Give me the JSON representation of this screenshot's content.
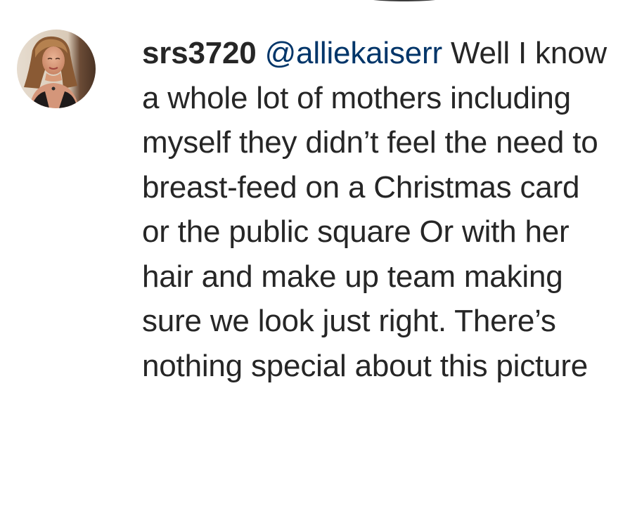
{
  "comment": {
    "username": "srs3720",
    "mention": "@alliekaiserr",
    "text": "Well I know a whole lot of mothers including myself they didn’t feel the need to breast-feed on a Christmas card or the public square Or with her hair and make up team making sure we look just right. There’s nothing special about this picture"
  },
  "colors": {
    "text": "#262626",
    "mention": "#003569",
    "background": "#ffffff"
  },
  "icons": {
    "avatar": "user-avatar-photo"
  }
}
